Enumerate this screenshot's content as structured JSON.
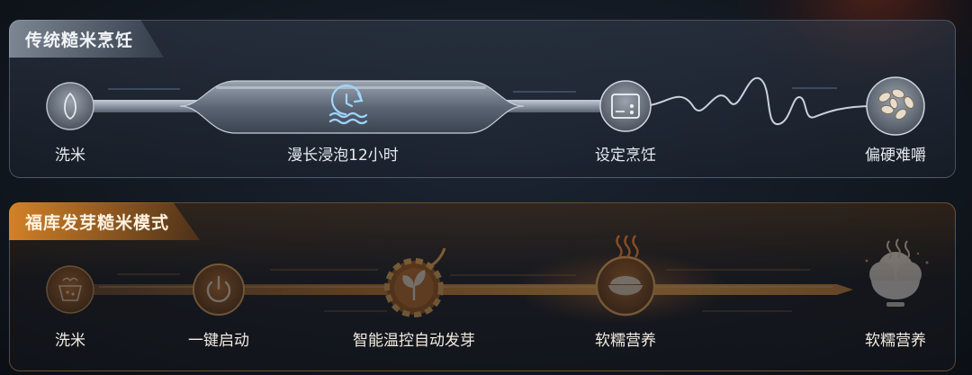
{
  "traditional": {
    "title": "传统糙米烹饪",
    "steps": [
      {
        "label": "洗米",
        "icon": "rice-grain-icon"
      },
      {
        "label": "漫长浸泡12小时",
        "icon": "clock-water-icon"
      },
      {
        "label": "设定烹饪",
        "icon": "cooker-panel-icon"
      },
      {
        "label": "偏硬难嚼",
        "icon": "hard-rice-icon"
      }
    ]
  },
  "sprout_mode": {
    "title": "福库发芽糙米模式",
    "steps": [
      {
        "label": "洗米",
        "icon": "wash-rice-icon"
      },
      {
        "label": "一键启动",
        "icon": "power-icon"
      },
      {
        "label": "智能温控自动发芽",
        "icon": "sprout-gear-icon"
      },
      {
        "label": "软糯营养",
        "icon": "steaming-rice-bowl-icon"
      },
      {
        "label": "软糯营养",
        "icon": "rice-bowl-icon"
      }
    ]
  },
  "colors": {
    "accent_orange": "#f0a040",
    "steel": "#8d98a8"
  }
}
